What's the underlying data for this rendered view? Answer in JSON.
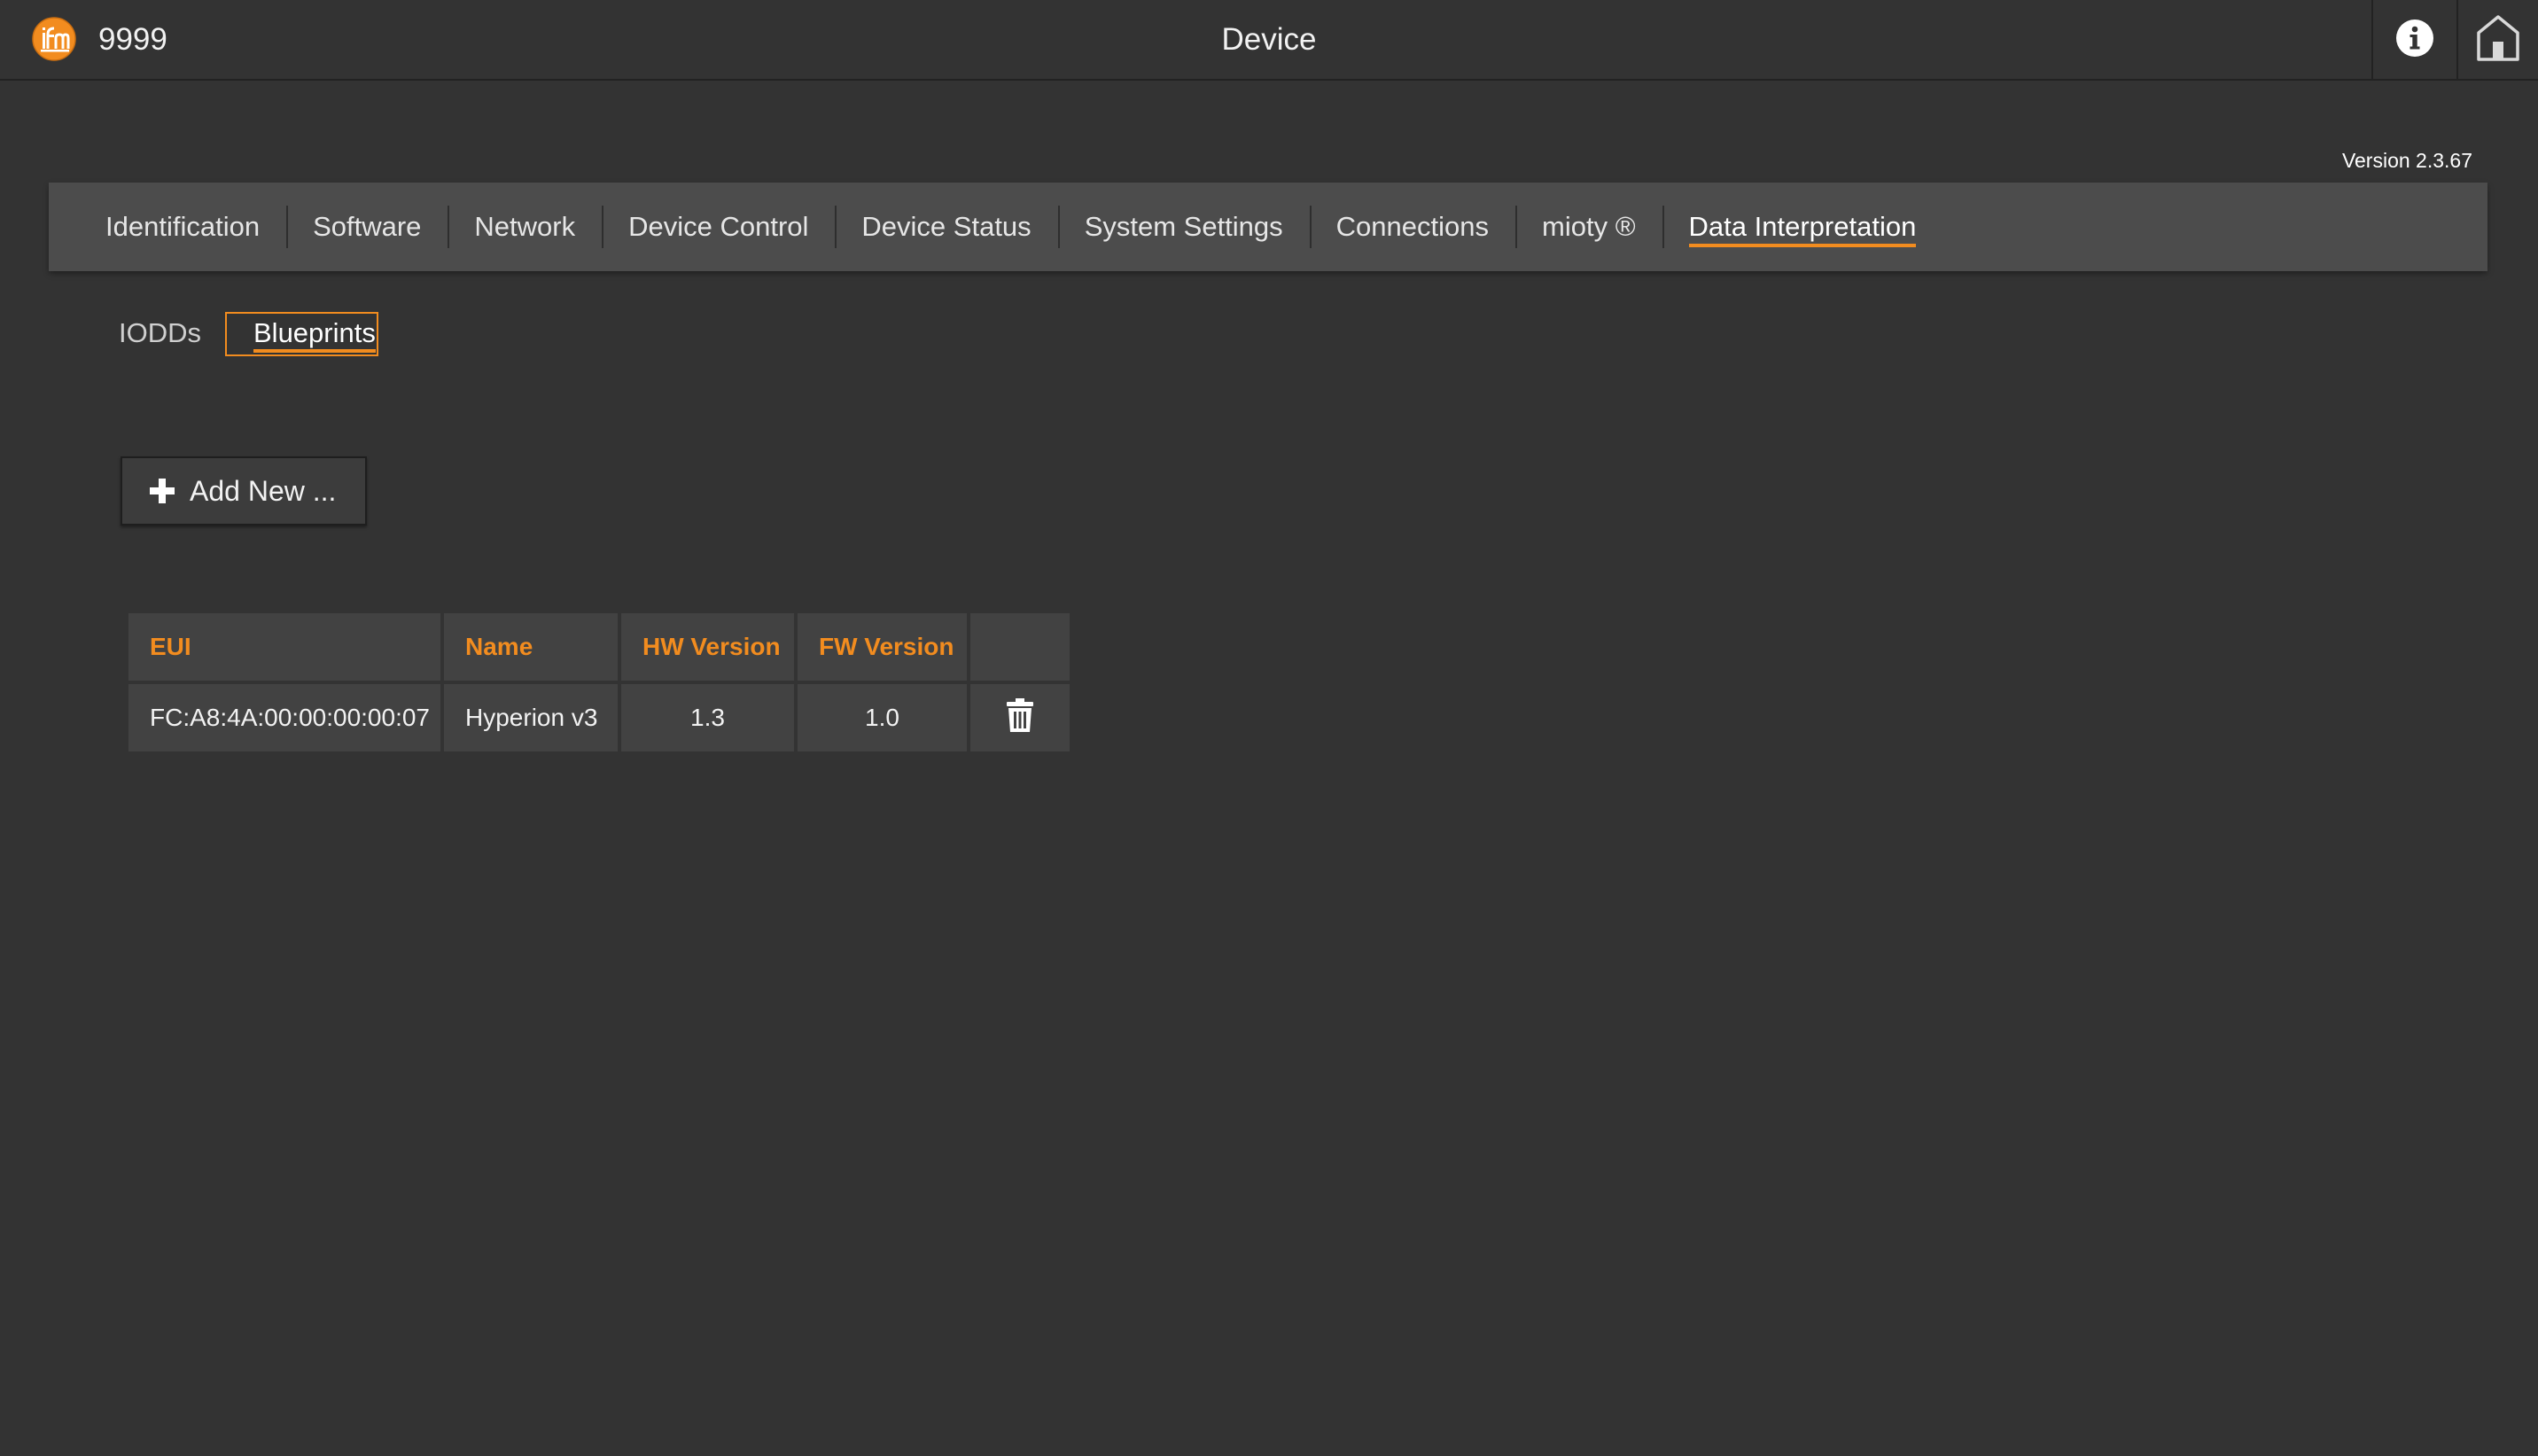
{
  "header": {
    "device_id": "9999",
    "title": "Device",
    "logo_icon": "ifm-logo-icon",
    "info_icon": "info-icon",
    "home_icon": "home-icon"
  },
  "version": "Version 2.3.67",
  "nav": {
    "tabs": [
      {
        "label": "Identification",
        "active": false
      },
      {
        "label": "Software",
        "active": false
      },
      {
        "label": "Network",
        "active": false
      },
      {
        "label": "Device Control",
        "active": false
      },
      {
        "label": "Device Status",
        "active": false
      },
      {
        "label": "System Settings",
        "active": false
      },
      {
        "label": "Connections",
        "active": false
      },
      {
        "label": "mioty ®",
        "active": false
      },
      {
        "label": "Data Interpretation",
        "active": true
      }
    ]
  },
  "subtabs": {
    "iodds": "IODDs",
    "blueprints": "Blueprints",
    "active": "Blueprints"
  },
  "add_button": {
    "label": "Add New ...",
    "icon": "plus-icon"
  },
  "table": {
    "headers": [
      "EUI",
      "Name",
      "HW Version",
      "FW Version",
      ""
    ],
    "rows": [
      {
        "eui": "FC:A8:4A:00:00:00:00:07",
        "name": "Hyperion v3",
        "hw_version": "1.3",
        "fw_version": "1.0",
        "action_icon": "trash-icon"
      }
    ]
  },
  "colors": {
    "background": "#333333",
    "navbar": "#4c4c4c",
    "accent": "#f28c1f",
    "cell": "#424242"
  }
}
